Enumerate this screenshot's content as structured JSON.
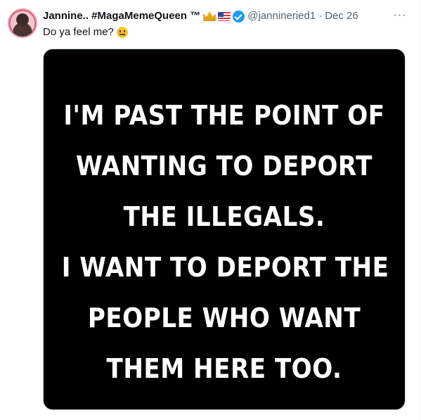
{
  "tweet": {
    "author_name": "Jannine.. #MagaMemeQueen ™",
    "handle": "@jannineried1",
    "separator": "·",
    "date": "Dec 26",
    "more_label": "···",
    "text": "Do ya feel me?",
    "icons": [
      "avatar",
      "crown-emoji",
      "us-flag-emoji",
      "verified-badge-icon",
      "neutral-face-emoji",
      "more-options-icon"
    ],
    "colors": {
      "verified": "#1d9bf0",
      "secondary_text": "#536471",
      "primary_text": "#0f1419"
    },
    "image_text_lines": [
      "I'M PAST THE POINT OF",
      "WANTING TO DEPORT",
      "THE ILLEGALS.",
      "I WANT TO DEPORT THE",
      "PEOPLE WHO WANT",
      "THEM HERE TOO."
    ]
  }
}
